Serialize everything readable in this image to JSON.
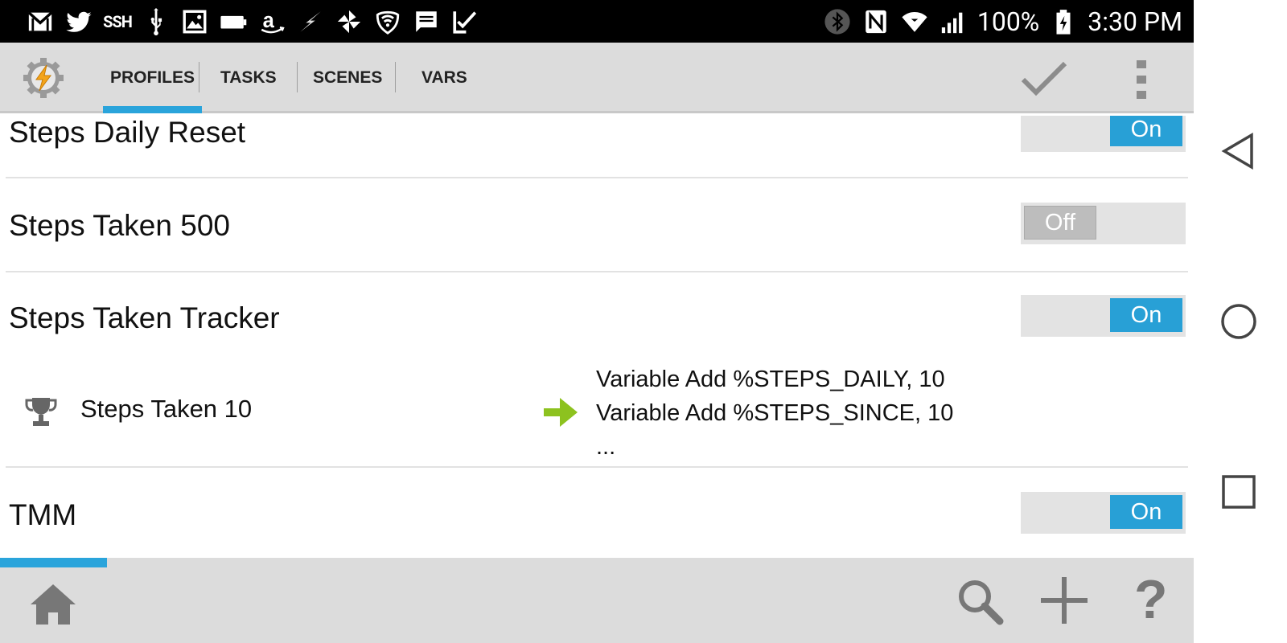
{
  "status_bar": {
    "left_icons": [
      "gmail-icon",
      "twitter-icon",
      "ssh-icon",
      "usb-icon",
      "image-icon",
      "battery-saver-icon",
      "amazon-icon",
      "flash-icon",
      "pinwheel-icon",
      "wifi-shield-icon",
      "message-icon",
      "checkmark-icon"
    ],
    "ssh_label": "SSH",
    "battery_percent": "100%",
    "time": "3:30 PM",
    "right_icons": [
      "bluetooth-icon",
      "nfc-icon",
      "wifi-icon",
      "signal-icon",
      "battery-charging-icon"
    ]
  },
  "action_bar": {
    "tabs": [
      {
        "label": "PROFILES",
        "active": true
      },
      {
        "label": "TASKS",
        "active": false
      },
      {
        "label": "SCENES",
        "active": false
      },
      {
        "label": "VARS",
        "active": false
      }
    ],
    "accent_color": "#2aa4db"
  },
  "profiles": [
    {
      "name": "Steps Daily Reset",
      "toggle": "On"
    },
    {
      "name": "Steps Taken 500",
      "toggle": "Off"
    },
    {
      "name": "Steps Taken Tracker",
      "toggle": "On",
      "context": "Steps Taken 10",
      "task_lines": [
        "Variable Add %STEPS_DAILY, 10",
        "Variable Add %STEPS_SINCE, 10",
        "..."
      ]
    },
    {
      "name": "TMM",
      "toggle": "On"
    }
  ],
  "bottom_bar": {
    "help_label": "?"
  },
  "nav_bar": [
    "back-icon",
    "home-circle-icon",
    "recents-icon"
  ]
}
